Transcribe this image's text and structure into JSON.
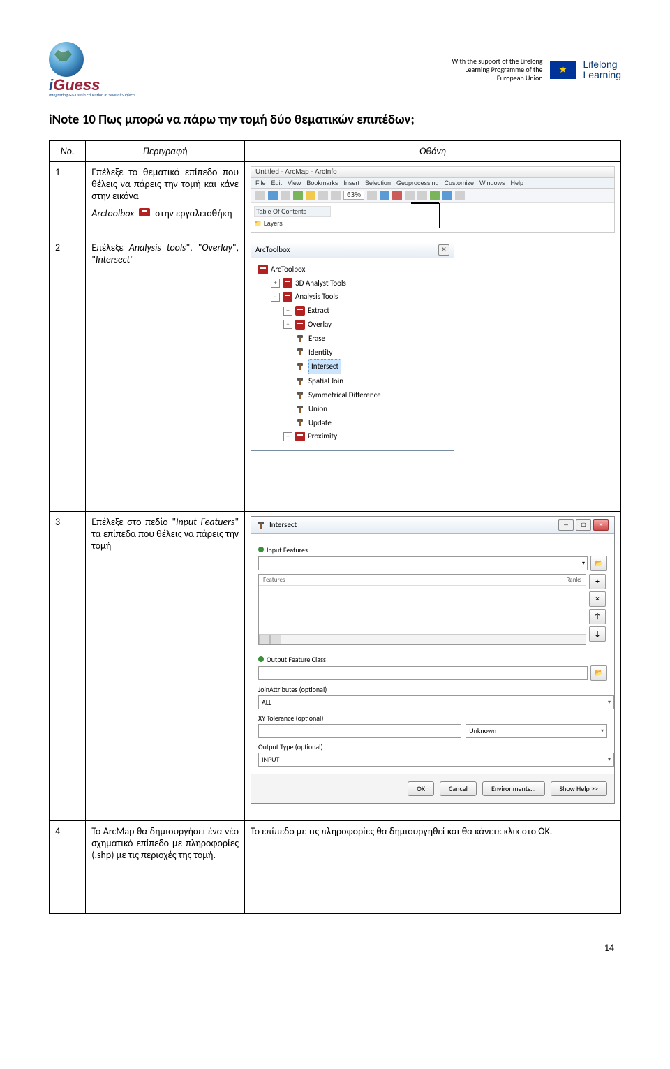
{
  "header": {
    "iguess": "Guess",
    "iguess_prefix": "i",
    "iguess_sub": "Integrating GIS Use in Education in Several Subjects",
    "support_line1": "With the support of the Lifelong",
    "support_line2": "Learning Programme of the",
    "support_line3": "European Union",
    "lifelong1": "Lifelong",
    "lifelong2": "Learning"
  },
  "title": "iNote 10   Πως μπορώ να  πάρω την τομή δύο θεματικών επιπέδων;",
  "table_head": {
    "no": "Νο.",
    "desc": "Περιγραφή",
    "screen": "Οθόνη"
  },
  "rows": {
    "r1": {
      "num": "1",
      "desc_line1": "Επέλεξε το θεματικό επίπεδο που θέλεις να πάρεις την τομή και κάνε στην  εικόνα",
      "desc_line2a": "Arctoolbox",
      "desc_line2b": "στην εργαλειοθήκη",
      "arcmap_title": "Untitled - ArcMap - ArcInfo",
      "menu": [
        "File",
        "Edit",
        "View",
        "Bookmarks",
        "Insert",
        "Selection",
        "Geoprocessing",
        "Customize",
        "Windows",
        "Help"
      ],
      "zoom": "63%",
      "toc": "Table Of Contents",
      "layers": "Layers"
    },
    "r2": {
      "num": "2",
      "desc": "Επέλεξε Analysis tools\", \"Overlay\", \"Intersect\"",
      "panel_title": "ArcToolbox",
      "tree": {
        "root": "ArcToolbox",
        "t1": "3D Analyst Tools",
        "t2": "Analysis Tools",
        "t2a": "Extract",
        "t2b": "Overlay",
        "t2b1": "Erase",
        "t2b2": "Identity",
        "t2b3": "Intersect",
        "t2b4": "Spatial Join",
        "t2b5": "Symmetrical Difference",
        "t2b6": "Union",
        "t2b7": "Update",
        "t2c": "Proximity"
      }
    },
    "r3": {
      "num": "3",
      "desc": "Επέλεξε στο πεδίο \"Input Featuers\" τα επίπεδα που θέλεις να πάρεις την τομή",
      "win_title": "Intersect",
      "input_features": "Input Features",
      "col_features": "Features",
      "col_ranks": "Ranks",
      "output": "Output Feature Class",
      "joinattr": "JoinAttributes (optional)",
      "joinattr_val": "ALL",
      "xytol": "XY Tolerance (optional)",
      "xytol_unit": "Unknown",
      "outtype": "Output Type (optional)",
      "outtype_val": "INPUT",
      "btn_ok": "OK",
      "btn_cancel": "Cancel",
      "btn_env": "Environments...",
      "btn_help": "Show Help >>"
    },
    "r4": {
      "num": "4",
      "desc": "Το ArcMap θα δημιουργήσει ένα νέο σχηματικό επίπεδο με πληροφορίες (.shp) με τις περιοχές της τομή.",
      "screen": "Το επίπεδο με τις πληροφορίες θα δημιουργηθεί και θα κάνετε κλικ στο ΟΚ."
    }
  },
  "page_number": "14"
}
